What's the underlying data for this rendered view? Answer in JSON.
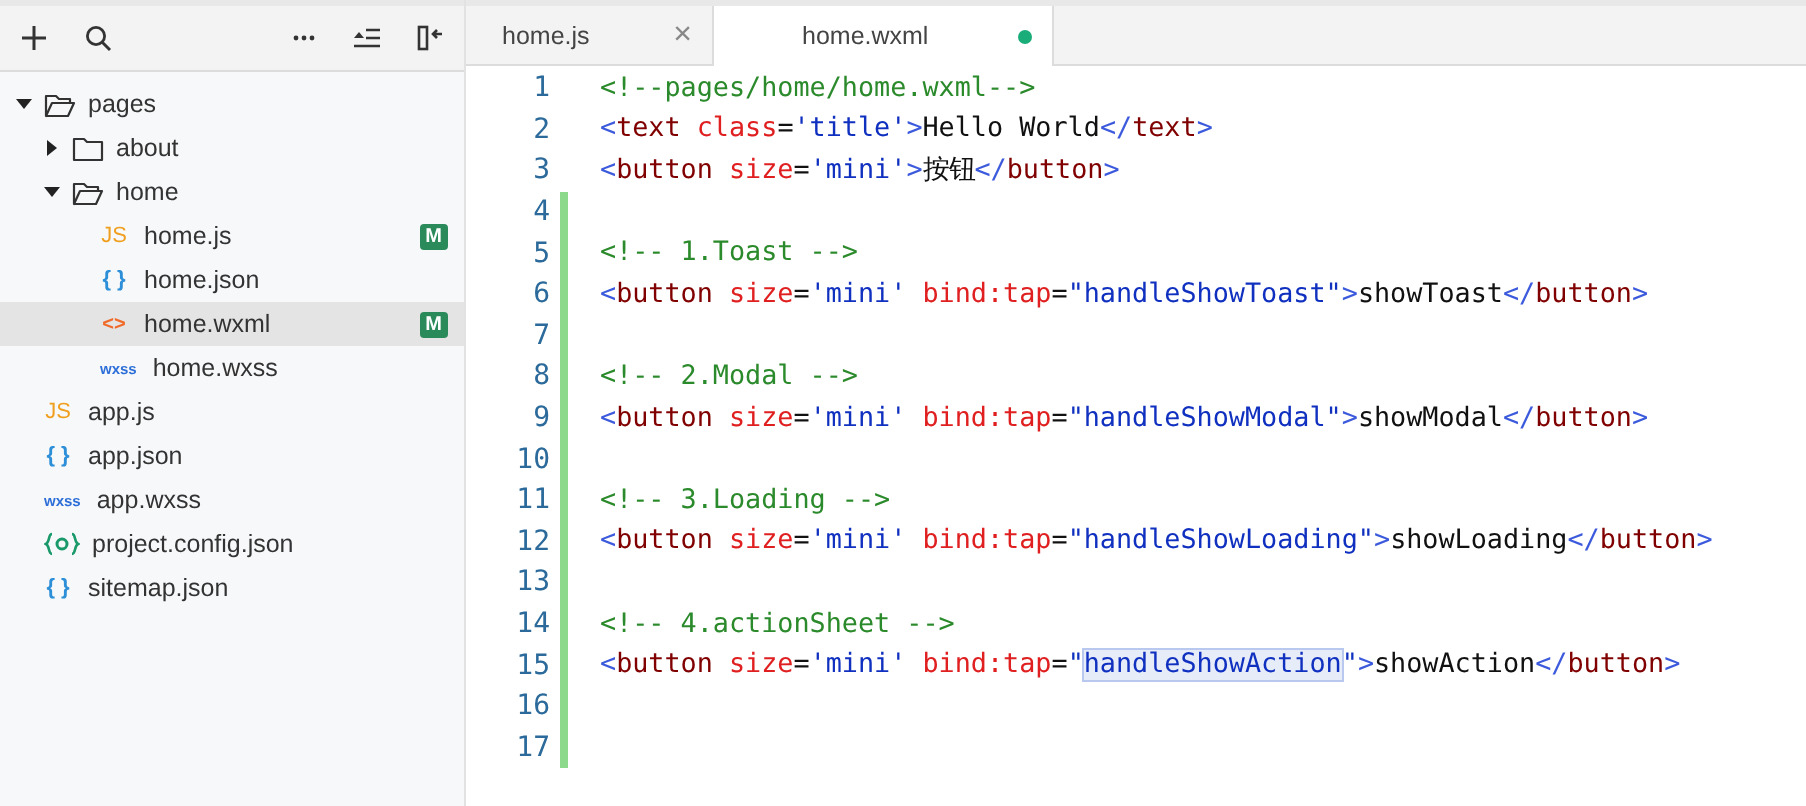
{
  "explorer": {
    "tree": [
      {
        "name": "pages",
        "kind": "folder",
        "expanded": true,
        "selected": false,
        "children": [
          {
            "name": "about",
            "kind": "folder",
            "expanded": false,
            "selected": false
          },
          {
            "name": "home",
            "kind": "folder",
            "expanded": true,
            "selected": false,
            "children": [
              {
                "name": "home.js",
                "kind": "js",
                "icon": "JS",
                "badge": "M",
                "selected": false
              },
              {
                "name": "home.json",
                "kind": "json",
                "icon": "{ }",
                "selected": false
              },
              {
                "name": "home.wxml",
                "kind": "wxml",
                "icon": "<>",
                "badge": "M",
                "selected": true
              },
              {
                "name": "home.wxss",
                "kind": "wxss",
                "icon": "wxss",
                "selected": false
              }
            ]
          }
        ]
      },
      {
        "name": "app.js",
        "kind": "js",
        "icon": "JS",
        "selected": false
      },
      {
        "name": "app.json",
        "kind": "json",
        "icon": "{ }",
        "selected": false
      },
      {
        "name": "app.wxss",
        "kind": "wxss",
        "icon": "wxss",
        "selected": false
      },
      {
        "name": "project.config.json",
        "kind": "config",
        "selected": false
      },
      {
        "name": "sitemap.json",
        "kind": "json",
        "icon": "{ }",
        "selected": false
      }
    ]
  },
  "tabs": [
    {
      "label": "home.js",
      "selected": false,
      "modified": false,
      "close": "×"
    },
    {
      "label": "home.wxml",
      "selected": true,
      "modified": true
    }
  ],
  "editor": {
    "lines": [
      {
        "number": "1",
        "changed": false,
        "tokens": [
          {
            "kind": "comment",
            "text": "<!--pages/home/home.wxml-->"
          }
        ]
      },
      {
        "number": "2",
        "changed": false,
        "tokens": [
          {
            "kind": "bracket",
            "text": "<"
          },
          {
            "kind": "tag",
            "text": "text"
          },
          {
            "kind": "attr",
            "text": " class"
          },
          {
            "kind": "text",
            "text": "="
          },
          {
            "kind": "value",
            "text": "'title'"
          },
          {
            "kind": "bracket",
            "text": ">"
          },
          {
            "kind": "text",
            "text": "Hello World"
          },
          {
            "kind": "bracket",
            "text": "</"
          },
          {
            "kind": "tag",
            "text": "text"
          },
          {
            "kind": "bracket",
            "text": ">"
          }
        ]
      },
      {
        "number": "3",
        "changed": false,
        "tokens": [
          {
            "kind": "bracket",
            "text": "<"
          },
          {
            "kind": "tag",
            "text": "button"
          },
          {
            "kind": "attr",
            "text": " size"
          },
          {
            "kind": "text",
            "text": "="
          },
          {
            "kind": "value",
            "text": "'mini'"
          },
          {
            "kind": "bracket",
            "text": ">"
          },
          {
            "kind": "text",
            "text": "按钮"
          },
          {
            "kind": "bracket",
            "text": "</"
          },
          {
            "kind": "tag",
            "text": "button"
          },
          {
            "kind": "bracket",
            "text": ">"
          }
        ]
      },
      {
        "number": "4",
        "changed": true
      },
      {
        "number": "5",
        "changed": true,
        "tokens": [
          {
            "kind": "comment",
            "text": "<!-- 1.Toast -->"
          }
        ]
      },
      {
        "number": "6",
        "changed": true,
        "tokens": [
          {
            "kind": "bracket",
            "text": "<"
          },
          {
            "kind": "tag",
            "text": "button"
          },
          {
            "kind": "attr",
            "text": " size"
          },
          {
            "kind": "text",
            "text": "="
          },
          {
            "kind": "value",
            "text": "'mini'"
          },
          {
            "kind": "attr",
            "text": " bind:tap"
          },
          {
            "kind": "text",
            "text": "="
          },
          {
            "kind": "value",
            "text": "\"handleShowToast\""
          },
          {
            "kind": "bracket",
            "text": ">"
          },
          {
            "kind": "text",
            "text": "showToast"
          },
          {
            "kind": "bracket",
            "text": "</"
          },
          {
            "kind": "tag",
            "text": "button"
          },
          {
            "kind": "bracket",
            "text": ">"
          }
        ]
      },
      {
        "number": "7",
        "changed": true
      },
      {
        "number": "8",
        "changed": true,
        "tokens": [
          {
            "kind": "comment",
            "text": "<!-- 2.Modal -->"
          }
        ]
      },
      {
        "number": "9",
        "changed": true,
        "tokens": [
          {
            "kind": "bracket",
            "text": "<"
          },
          {
            "kind": "tag",
            "text": "button"
          },
          {
            "kind": "attr",
            "text": " size"
          },
          {
            "kind": "text",
            "text": "="
          },
          {
            "kind": "value",
            "text": "'mini'"
          },
          {
            "kind": "attr",
            "text": " bind:tap"
          },
          {
            "kind": "text",
            "text": "="
          },
          {
            "kind": "value",
            "text": "\"handleShowModal\""
          },
          {
            "kind": "bracket",
            "text": ">"
          },
          {
            "kind": "text",
            "text": "showModal"
          },
          {
            "kind": "bracket",
            "text": "</"
          },
          {
            "kind": "tag",
            "text": "button"
          },
          {
            "kind": "bracket",
            "text": ">"
          }
        ]
      },
      {
        "number": "10",
        "changed": true
      },
      {
        "number": "11",
        "changed": true,
        "tokens": [
          {
            "kind": "comment",
            "text": "<!-- 3.Loading -->"
          }
        ]
      },
      {
        "number": "12",
        "changed": true,
        "tokens": [
          {
            "kind": "bracket",
            "text": "<"
          },
          {
            "kind": "tag",
            "text": "button"
          },
          {
            "kind": "attr",
            "text": " size"
          },
          {
            "kind": "text",
            "text": "="
          },
          {
            "kind": "value",
            "text": "'mini'"
          },
          {
            "kind": "attr",
            "text": " bind:tap"
          },
          {
            "kind": "text",
            "text": "="
          },
          {
            "kind": "value",
            "text": "\"handleShowLoading\""
          },
          {
            "kind": "bracket",
            "text": ">"
          },
          {
            "kind": "text",
            "text": "showLoading"
          },
          {
            "kind": "bracket",
            "text": "</"
          },
          {
            "kind": "tag",
            "text": "button"
          },
          {
            "kind": "bracket",
            "text": ">"
          }
        ]
      },
      {
        "number": "13",
        "changed": true
      },
      {
        "number": "14",
        "changed": true,
        "tokens": [
          {
            "kind": "comment",
            "text": "<!-- 4.actionSheet -->"
          }
        ]
      },
      {
        "number": "15",
        "changed": true,
        "tokens": [
          {
            "kind": "bracket",
            "text": "<"
          },
          {
            "kind": "tag",
            "text": "button"
          },
          {
            "kind": "attr",
            "text": " size"
          },
          {
            "kind": "text",
            "text": "="
          },
          {
            "kind": "value",
            "text": "'mini'"
          },
          {
            "kind": "attr",
            "text": " bind:tap"
          },
          {
            "kind": "text",
            "text": "="
          },
          {
            "kind": "value",
            "text": "\""
          },
          {
            "kind": "value",
            "text": "handleShowAction",
            "highlighted": true
          },
          {
            "kind": "value",
            "text": "\""
          },
          {
            "kind": "bracket",
            "text": ">"
          },
          {
            "kind": "text",
            "text": "showAction"
          },
          {
            "kind": "bracket",
            "text": "</"
          },
          {
            "kind": "tag",
            "text": "button"
          },
          {
            "kind": "bracket",
            "text": ">"
          }
        ]
      },
      {
        "number": "16",
        "changed": true
      },
      {
        "number": "17",
        "changed": true
      }
    ]
  }
}
